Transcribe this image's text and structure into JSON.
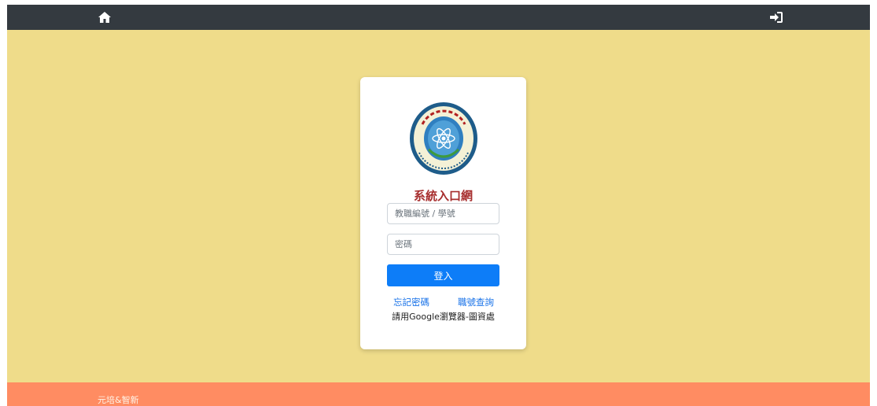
{
  "nav": {
    "home_icon": "home-icon",
    "signin_icon": "sign-in-icon"
  },
  "login": {
    "title": "系統入口網",
    "username_placeholder": "教職編號 / 學號",
    "password_placeholder": "密碼",
    "submit_label": "登入",
    "forgot_link": "忘記密碼",
    "lookup_link": "職號查詢",
    "browser_note": "請用Google瀏覽器-圖資處",
    "logo_text_top": "元培醫事科技大學",
    "logo_text_bottom": "YUANPEI UNIVERSITY OF MEDICAL TECHNOLOGY",
    "logo_year": "1964"
  },
  "footer": {
    "text": "元培&智新"
  },
  "colors": {
    "navbar": "#343a40",
    "background": "#efdc8a",
    "footer": "#ff8c62",
    "title": "#a72e2e",
    "button": "#0d7df8",
    "link": "#1a73e8"
  }
}
